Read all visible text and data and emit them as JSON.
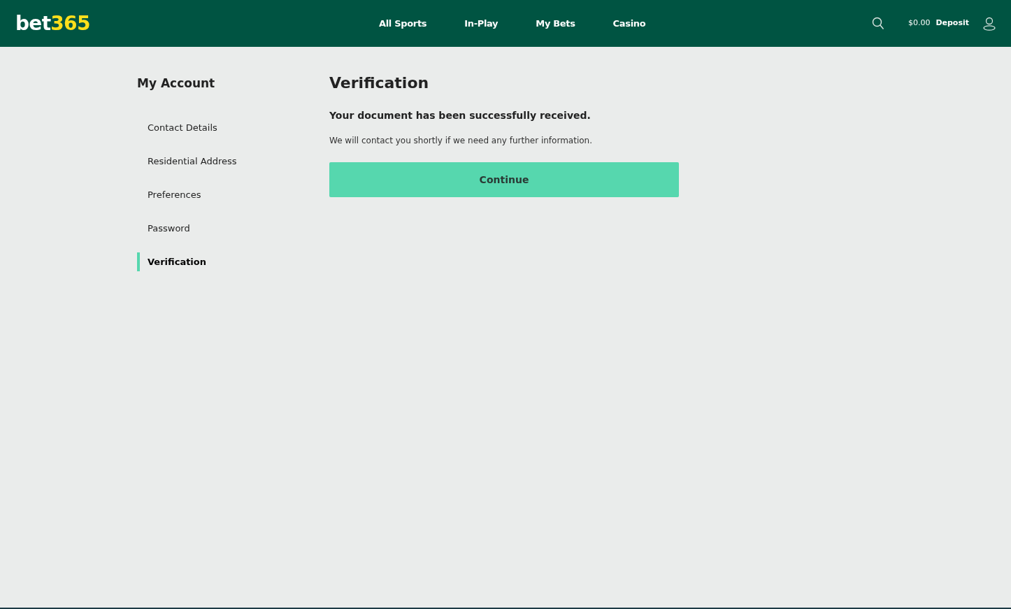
{
  "header": {
    "logo": {
      "main": "bet",
      "accent": "365"
    },
    "nav": [
      {
        "label": "All Sports"
      },
      {
        "label": "In-Play"
      },
      {
        "label": "My Bets"
      },
      {
        "label": "Casino"
      }
    ],
    "balance": "$0.00",
    "deposit": "Deposit"
  },
  "sidebar": {
    "title": "My Account",
    "items": [
      {
        "label": "Contact Details",
        "selected": false
      },
      {
        "label": "Residential Address",
        "selected": false
      },
      {
        "label": "Preferences",
        "selected": false
      },
      {
        "label": "Password",
        "selected": false
      },
      {
        "label": "Verification",
        "selected": true
      }
    ]
  },
  "main": {
    "title": "Verification",
    "heading": "Your document has been successfully received.",
    "message": "We will contact you shortly if we need any further information.",
    "button": "Continue"
  }
}
